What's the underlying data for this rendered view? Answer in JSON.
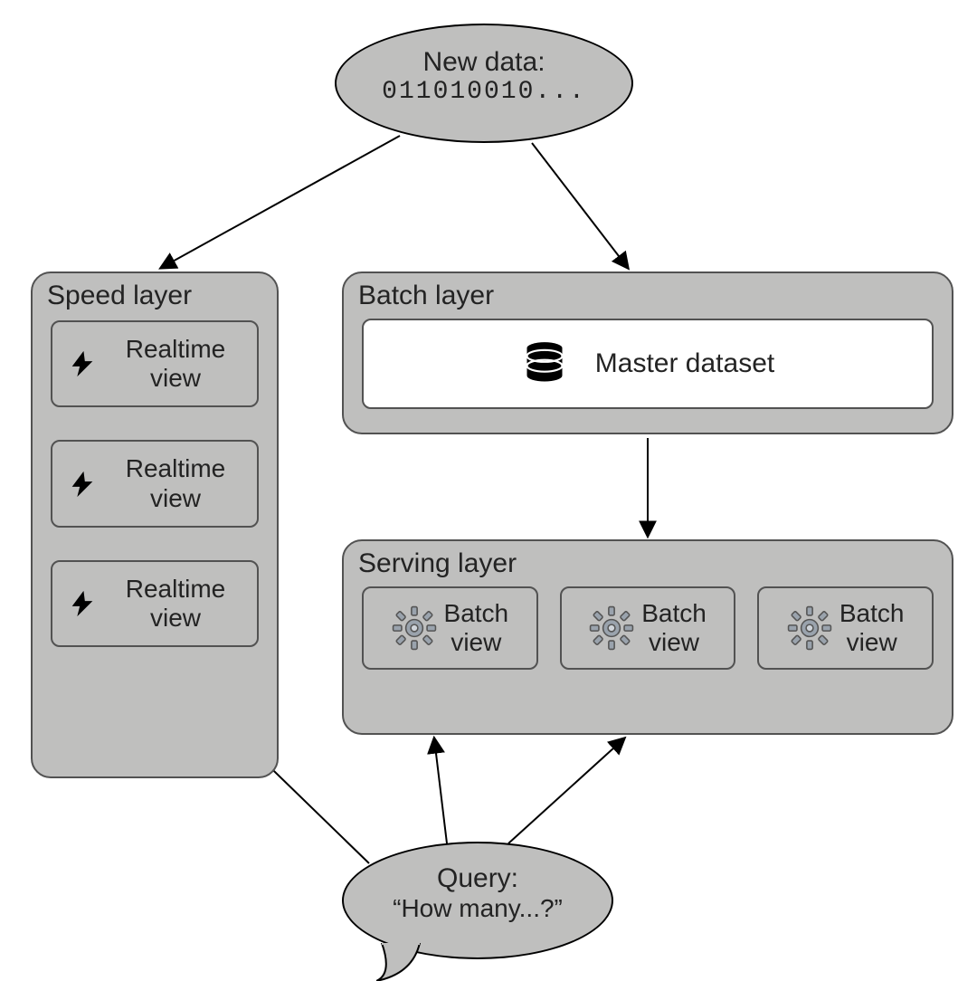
{
  "newData": {
    "line1": "New data:",
    "line2": "011010010..."
  },
  "speedLayer": {
    "title": "Speed layer",
    "items": [
      "Realtime\nview",
      "Realtime\nview",
      "Realtime\nview"
    ]
  },
  "batchLayer": {
    "title": "Batch layer",
    "master": "Master dataset"
  },
  "servingLayer": {
    "title": "Serving layer",
    "items": [
      "Batch\nview",
      "Batch\nview",
      "Batch\nview"
    ]
  },
  "query": {
    "line1": "Query:",
    "line2": "“How many...?”"
  }
}
